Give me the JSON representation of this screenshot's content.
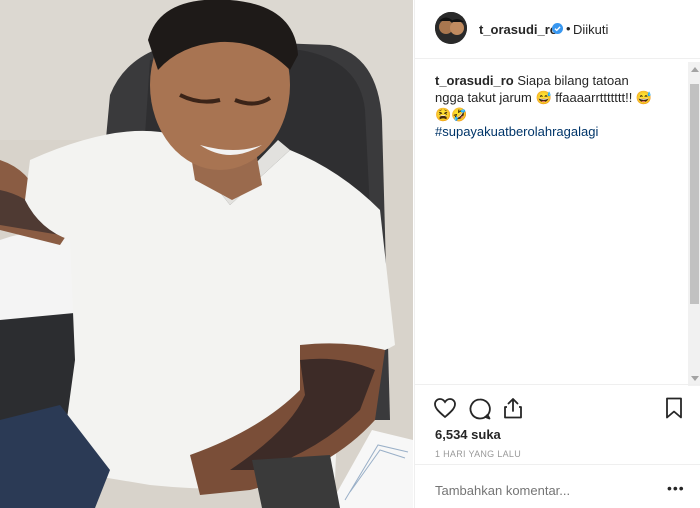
{
  "post": {
    "username": "t_orasudi_ro",
    "follow_status": "Diikuti",
    "caption": {
      "username": "t_orasudi_ro",
      "text": "Siapa bilang tatoan ngga takut jarum 😅 ffaaaarrttttttt!! 😅😫🤣",
      "hashtag": "#supayakuatberolahragalagi"
    },
    "likes": "6,534 suka",
    "timestamp": "1 HARI YANG LALU",
    "comment_placeholder": "Tambahkan komentar...",
    "more_label": "•••"
  },
  "icons": {
    "like": "heart-icon",
    "comment": "comment-icon",
    "share": "share-icon",
    "save": "bookmark-icon",
    "verified": "verified-badge-icon"
  },
  "colors": {
    "verified": "#3897f0",
    "hashtag": "#003569",
    "muted": "#999999",
    "text": "#262626"
  }
}
